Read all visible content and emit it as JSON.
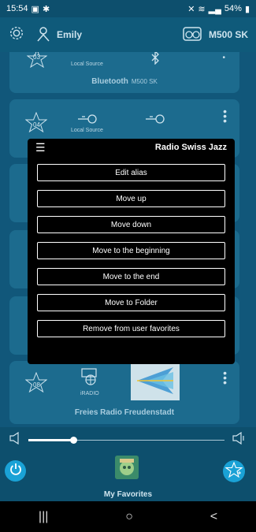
{
  "status": {
    "time": "15:54",
    "battery": "54%"
  },
  "topbar": {
    "user_name": "Emily",
    "device_name": "M500 SK"
  },
  "cards": [
    {
      "number": "03",
      "source_label": "Local Source",
      "title": "Bluetooth",
      "subtitle": "M500 SK"
    },
    {
      "number": "04",
      "source_label": "Local Source"
    },
    {
      "number": "08",
      "source_label": "iRADIO",
      "title": "Freies Radio Freudenstadt"
    }
  ],
  "menu": {
    "title": "Radio Swiss Jazz",
    "options": [
      "Edit alias",
      "Move up",
      "Move down",
      "Move to the beginning",
      "Move to the end",
      "Move to Folder",
      "Remove from user favorites"
    ]
  },
  "volume": {
    "level": 0.23
  },
  "player": {
    "label": "My Favorites"
  },
  "colors": {
    "accent": "#1aa2d6",
    "background": "#0d4f6d",
    "card": "#1c6b8e"
  },
  "icons": [
    "gear-icon",
    "person-icon",
    "speaker-device-icon",
    "star-icon",
    "bluetooth-icon",
    "key-icon",
    "more-icon",
    "hamburger-icon",
    "radio-icon",
    "volume-low-icon",
    "volume-high-icon",
    "power-icon",
    "star-plus-icon"
  ]
}
